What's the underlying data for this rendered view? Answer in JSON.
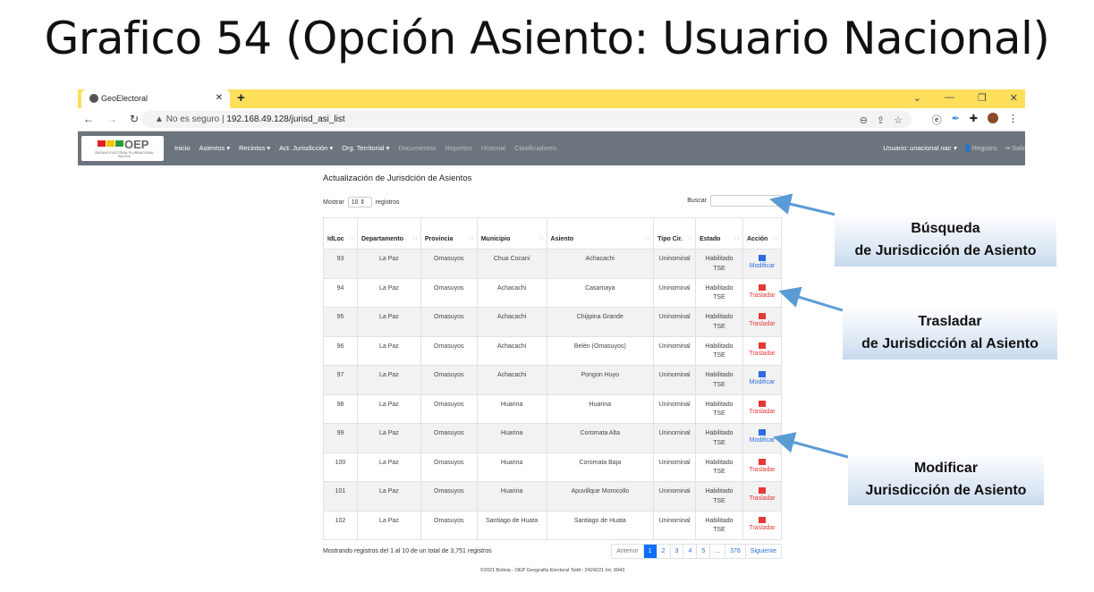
{
  "slide_title": "Grafico 54 (Opción Asiento: Usuario Nacional)",
  "browser": {
    "tab_title": "GeoElectoral",
    "security": "No es seguro",
    "url": "192.168.49.128/jurisd_asi_list"
  },
  "navbar": {
    "logo": "OEP",
    "logo_sub": "ÓRGANO ELECTORAL PLURINACIONAL BOLIVIA",
    "items": [
      "Inicio",
      "Asientos ▾",
      "Recintos ▾",
      "Act. Jurisdicción ▾",
      "Org. Territorial ▾"
    ],
    "disabled_items": [
      "Documentos",
      "Reportes",
      "Historial",
      "Clasificadores"
    ],
    "user": "Usuario: unacional nac ▾",
    "registro": "Registro",
    "salir": "Salir"
  },
  "page": {
    "heading": "Actualización de Jurisdción de Asientos",
    "show_label": "Mostrar",
    "page_size": "10",
    "records_label": "registros",
    "search_label": "Buscar",
    "search_value": ""
  },
  "table": {
    "headers": [
      "IdLoc",
      "Departamento",
      "Provincia",
      "Municipio",
      "Asiento",
      "Tipo Cir.",
      "Estado",
      "Acción"
    ],
    "rows": [
      [
        "93",
        "La Paz",
        "Omasuyos",
        "Chua Cocani",
        "Achacachi",
        "Uninominal",
        "Habilitado TSE",
        "Modificar"
      ],
      [
        "94",
        "La Paz",
        "Omasuyos",
        "Achacachi",
        "Casamaya",
        "Uninominal",
        "Habilitado TSE",
        "Trasladar"
      ],
      [
        "95",
        "La Paz",
        "Omasuyos",
        "Achacachi",
        "Chijipina Grande",
        "Uninominal",
        "Habilitado TSE",
        "Trasladar"
      ],
      [
        "96",
        "La Paz",
        "Omasuyos",
        "Achacachi",
        "Belén (Omasuyos)",
        "Uninominal",
        "Habilitado TSE",
        "Trasladar"
      ],
      [
        "97",
        "La Paz",
        "Omasuyos",
        "Achacachi",
        "Pongon Huyo",
        "Uninominal",
        "Habilitado TSE",
        "Modificar"
      ],
      [
        "98",
        "La Paz",
        "Omasuyos",
        "Huarina",
        "Huarina",
        "Uninominal",
        "Habilitado TSE",
        "Trasladar"
      ],
      [
        "99",
        "La Paz",
        "Omasuyos",
        "Huarina",
        "Coromata Alta",
        "Uninominal",
        "Habilitado TSE",
        "Modificar"
      ],
      [
        "100",
        "La Paz",
        "Omasuyos",
        "Huarina",
        "Coromata Baja",
        "Uninominal",
        "Habilitado TSE",
        "Trasladar"
      ],
      [
        "101",
        "La Paz",
        "Omasuyos",
        "Huarina",
        "Apuvillque Morocollo",
        "Uninominal",
        "Habilitado TSE",
        "Trasladar"
      ],
      [
        "102",
        "La Paz",
        "Omasuyos",
        "Santiago de Huata",
        "Santiago de Huata",
        "Uninominal",
        "Habilitado TSE",
        "Trasladar"
      ]
    ]
  },
  "footer": {
    "info": "Mostrando registros del 1 al 10 de un total de 3,751 registros",
    "pagination": [
      "Anterior",
      "1",
      "2",
      "3",
      "4",
      "5",
      "...",
      "376",
      "Siguiente"
    ],
    "active_page": "1",
    "copyright": "©2021 Bolivia - OEP Geografía Electoral Teléf.: 2424221 Int. 9943"
  },
  "callouts": [
    {
      "line1": "Búsqueda",
      "line2": "de Jurisdicción de Asiento"
    },
    {
      "line1": "Trasladar",
      "line2": "de Jurisdicción al Asiento"
    },
    {
      "line1": "Modificar",
      "line2": "Jurisdicción de Asiento"
    }
  ],
  "colors": {
    "tabbar": "#fddf5c",
    "navbar": "#6c757d",
    "modificar": "#2e6de0",
    "trasladar": "#e53935",
    "arrow": "#5b9bd5"
  }
}
